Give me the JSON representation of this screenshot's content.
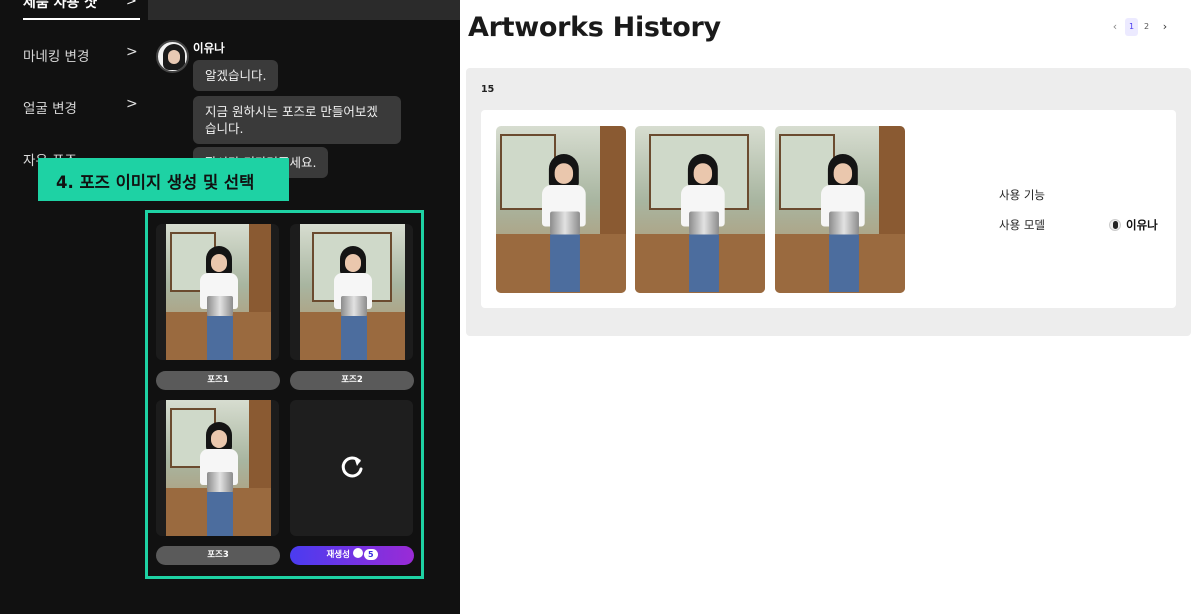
{
  "sidebar": {
    "active_item": "제품 사용 샷",
    "items": [
      {
        "label": "마네킹 변경"
      },
      {
        "label": "얼굴 변경"
      },
      {
        "label": "자유 포즈"
      }
    ]
  },
  "chat": {
    "sender": "이유나",
    "messages": [
      "알겠습니다.",
      "지금 원하시는 포즈로 만들어보겠습니다.",
      "잠시만 기다려주세요."
    ]
  },
  "step_banner": "4. 포즈 이미지 생성  및 선택",
  "pose_options": [
    {
      "label": "포즈1"
    },
    {
      "label": "포즈2"
    },
    {
      "label": "포즈3"
    }
  ],
  "regenerate": {
    "label": "재생성",
    "credits": "5",
    "icon": "refresh-icon"
  },
  "history": {
    "title": "Artworks History",
    "pagination": {
      "prev": "‹",
      "pages": [
        "1",
        "2"
      ],
      "current": "1",
      "next": "›"
    },
    "count": "15",
    "meta": {
      "feature_label": "사용 기능",
      "feature_value": "",
      "model_label": "사용 모델",
      "model_value": "이유나"
    }
  },
  "colors": {
    "accent": "#1ed2a4",
    "regen_gradient_start": "#4a3cf0",
    "regen_gradient_end": "#9a2bd6",
    "sidebar_bg": "#111111"
  }
}
